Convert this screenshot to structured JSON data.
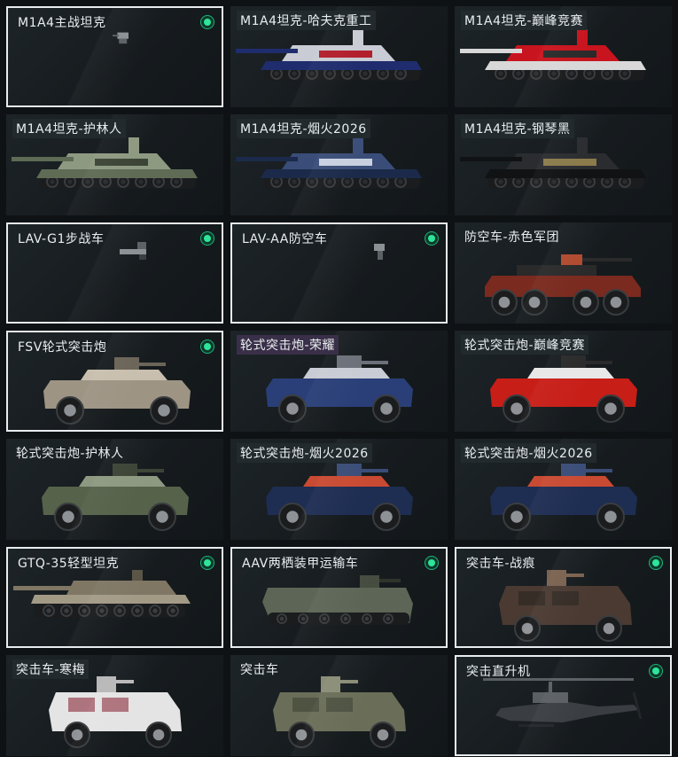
{
  "cards": [
    {
      "name": "M1A4主战坦克",
      "selected": true,
      "owned": true,
      "label_style": "plain",
      "shape": "tiny-tank",
      "colors": [
        "#8a9094",
        "#5b6166",
        "#3a3f43"
      ]
    },
    {
      "name": "M1A4坦克-哈夫克重工",
      "selected": false,
      "owned": false,
      "label_style": "hl",
      "shape": "tank",
      "colors": [
        "#1f2d6e",
        "#c9ccd4",
        "#b21f2d"
      ]
    },
    {
      "name": "M1A4坦克-巅峰竞赛",
      "selected": false,
      "owned": false,
      "label_style": "hl",
      "shape": "tank",
      "colors": [
        "#d8d8d8",
        "#c8141e",
        "#2a2a2a"
      ]
    },
    {
      "name": "M1A4坦克-护林人",
      "selected": false,
      "owned": false,
      "label_style": "hl",
      "shape": "tank",
      "colors": [
        "#5f6b55",
        "#8e9981",
        "#3c4436"
      ]
    },
    {
      "name": "M1A4坦克-烟火2026",
      "selected": false,
      "owned": false,
      "label_style": "hl",
      "shape": "tank",
      "colors": [
        "#1b2a4a",
        "#3a4d78",
        "#c8d0e0"
      ]
    },
    {
      "name": "M1A4坦克-钢琴黑",
      "selected": false,
      "owned": false,
      "label_style": "hl",
      "shape": "tank",
      "colors": [
        "#111214",
        "#2a2c2f",
        "#8b7a4a"
      ]
    },
    {
      "name": "LAV-G1步战车",
      "selected": true,
      "owned": true,
      "label_style": "plain",
      "shape": "tiny-apc",
      "colors": [
        "#8a9094",
        "#5b6166",
        "#3a3f43"
      ]
    },
    {
      "name": "LAV-AA防空车",
      "selected": true,
      "owned": true,
      "label_style": "plain",
      "shape": "tiny-aa",
      "colors": [
        "#8a9094",
        "#5b6166",
        "#3a3f43"
      ]
    },
    {
      "name": "防空车-赤色军团",
      "selected": false,
      "owned": false,
      "label_style": "plain",
      "shape": "apc8",
      "colors": [
        "#7a2a1e",
        "#2a2a2a",
        "#b04a2e"
      ]
    },
    {
      "name": "FSV轮式突击炮",
      "selected": true,
      "owned": true,
      "label_style": "plain",
      "shape": "armored-car",
      "colors": [
        "#9e9484",
        "#c8bfae",
        "#6b6458"
      ]
    },
    {
      "name": "轮式突击炮-荣耀",
      "selected": false,
      "owned": false,
      "label_style": "purple",
      "shape": "armored-car",
      "colors": [
        "#2a3f78",
        "#c9ccd4",
        "#6c7079"
      ]
    },
    {
      "name": "轮式突击炮-巅峰竞赛",
      "selected": false,
      "owned": false,
      "label_style": "hl",
      "shape": "armored-car",
      "colors": [
        "#c81e18",
        "#e8e8e8",
        "#2a2a2a"
      ]
    },
    {
      "name": "轮式突击炮-护林人",
      "selected": false,
      "owned": false,
      "label_style": "plain",
      "shape": "armored-car",
      "colors": [
        "#56624a",
        "#8e9981",
        "#3c4436"
      ]
    },
    {
      "name": "轮式突击炮-烟火2026",
      "selected": false,
      "owned": false,
      "label_style": "hl",
      "shape": "armored-car",
      "colors": [
        "#1e2d52",
        "#c94a32",
        "#3a4d78"
      ]
    },
    {
      "name": "轮式突击炮-烟火2026",
      "selected": false,
      "owned": false,
      "label_style": "hl",
      "shape": "armored-car",
      "colors": [
        "#1e2d52",
        "#c94a32",
        "#3a4d78"
      ]
    },
    {
      "name": "GTQ-35轻型坦克",
      "selected": true,
      "owned": true,
      "label_style": "plain",
      "shape": "light-tank",
      "colors": [
        "#a39a86",
        "#7f7764",
        "#5a5446"
      ]
    },
    {
      "name": "AAV两栖装甲运输车",
      "selected": true,
      "owned": true,
      "label_style": "plain",
      "shape": "aav",
      "colors": [
        "#5d6656",
        "#454c40",
        "#2f342b"
      ]
    },
    {
      "name": "突击车-战痕",
      "selected": true,
      "owned": true,
      "label_style": "plain",
      "shape": "mrap",
      "colors": [
        "#4a3a32",
        "#7a6250",
        "#2a2420"
      ]
    },
    {
      "name": "突击车-寒梅",
      "selected": false,
      "owned": false,
      "label_style": "hl",
      "shape": "mrap",
      "colors": [
        "#e4e4e4",
        "#b8b8b8",
        "#8a2a3a"
      ]
    },
    {
      "name": "突击车",
      "selected": false,
      "owned": false,
      "label_style": "plain",
      "shape": "mrap",
      "colors": [
        "#6a6e58",
        "#8a8d76",
        "#3e4134"
      ]
    },
    {
      "name": "突击直升机",
      "selected": true,
      "owned": true,
      "label_style": "plain",
      "shape": "heli",
      "colors": [
        "#3a3e42",
        "#5a5f64",
        "#24272a"
      ]
    }
  ]
}
